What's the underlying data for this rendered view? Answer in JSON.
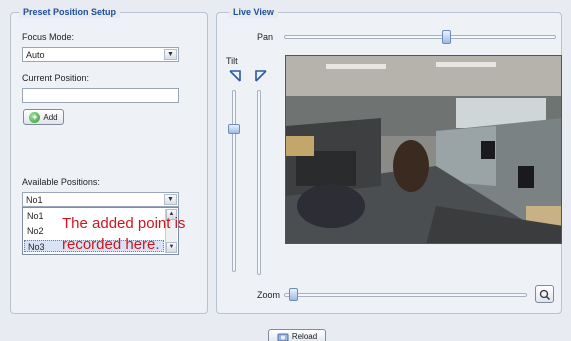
{
  "preset": {
    "legend": "Preset Position Setup",
    "focus_mode_label": "Focus Mode:",
    "focus_mode_value": "Auto",
    "current_position_label": "Current Position:",
    "current_position_value": "",
    "add_label": "Add",
    "available_positions_label": "Available Positions:",
    "available_selected": "No1",
    "available_options": [
      "No1",
      "No2",
      "No3"
    ]
  },
  "annotation": {
    "line1": "The added point is",
    "line2": "recorded here."
  },
  "live_view": {
    "legend": "Live View",
    "pan_label": "Pan",
    "tilt_label": "Tilt",
    "zoom_label": "Zoom",
    "pan_level": 0.6,
    "tilt_level": 0.2,
    "zoom_level": 0.02
  },
  "reload_label": "Reload",
  "colors": {
    "legend": "#1f4e9a",
    "annotation": "#d0151b",
    "selected_row": "#d8e4f5"
  }
}
